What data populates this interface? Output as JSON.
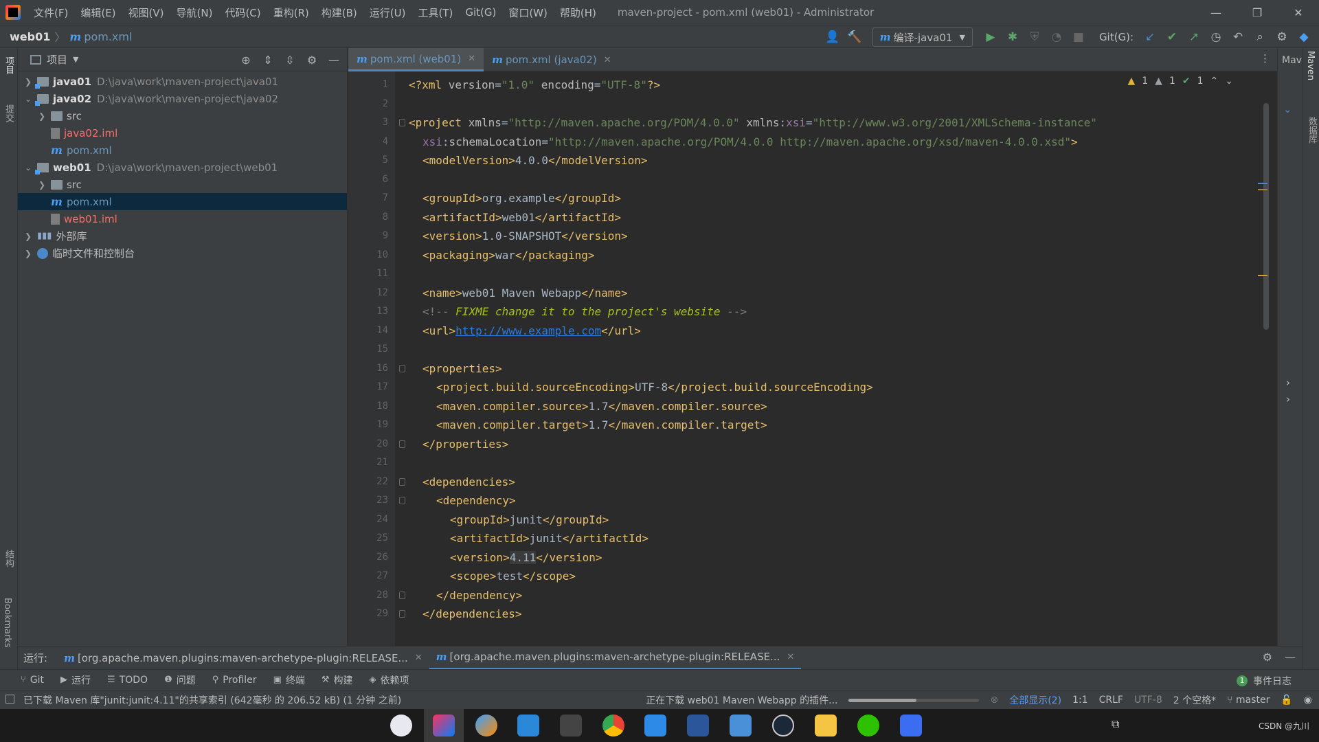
{
  "menubar": {
    "items": [
      "文件(F)",
      "编辑(E)",
      "视图(V)",
      "导航(N)",
      "代码(C)",
      "重构(R)",
      "构建(B)",
      "运行(U)",
      "工具(T)",
      "Git(G)",
      "窗口(W)",
      "帮助(H)"
    ],
    "title": "maven-project - pom.xml (web01) - Administrator"
  },
  "navbar": {
    "crumb_module": "web01",
    "crumb_file": "pom.xml",
    "run_config": "编译-java01",
    "git_label": "Git(G):"
  },
  "left_stripe": {
    "project": "项目",
    "commit": "提交",
    "structure": "结构",
    "bookmarks": "Bookmarks"
  },
  "project": {
    "title": "项目",
    "tree": [
      {
        "name": "java01",
        "path": "D:\\java\\work\\maven-project\\java01"
      },
      {
        "name": "java02",
        "path": "D:\\java\\work\\maven-project\\java02"
      },
      {
        "name": "src"
      },
      {
        "name": "java02.iml"
      },
      {
        "name": "pom.xml"
      },
      {
        "name": "web01",
        "path": "D:\\java\\work\\maven-project\\web01"
      },
      {
        "name": "src"
      },
      {
        "name": "pom.xml"
      },
      {
        "name": "web01.iml"
      },
      {
        "name": "外部库"
      },
      {
        "name": "临时文件和控制台"
      }
    ]
  },
  "editor": {
    "tabs": [
      {
        "label": "pom.xml (web01)"
      },
      {
        "label": "pom.xml (java02)"
      }
    ],
    "inspection": {
      "warn1": "1",
      "warn2": "1",
      "ok": "1"
    },
    "line_numbers": [
      "1",
      "2",
      "3",
      "4",
      "5",
      "6",
      "7",
      "8",
      "9",
      "10",
      "11",
      "12",
      "13",
      "14",
      "15",
      "16",
      "17",
      "18",
      "19",
      "20",
      "21",
      "22",
      "23",
      "24",
      "25",
      "26",
      "27",
      "28",
      "29"
    ],
    "code": {
      "l1": {
        "open": "<?xml ",
        "a1": "version",
        "eq1": "=",
        "v1": "\"1.0\"",
        "sp": " ",
        "a2": "encoding",
        "eq2": "=",
        "v2": "\"UTF-8\"",
        "close": "?>"
      },
      "l3": {
        "open": "<project ",
        "a1": "xmlns",
        "eq1": "=",
        "v1": "\"http://maven.apache.org/POM/4.0.0\"",
        "sp": " ",
        "a2": "xmlns",
        "colon": ":",
        "ns": "xsi",
        "eq2": "=",
        "v2": "\"http://www.w3.org/2001/XMLSchema-instance\""
      },
      "l4": {
        "ns": "xsi",
        "colon": ":",
        "a": "schemaLocation",
        "eq": "=",
        "v": "\"http://maven.apache.org/POM/4.0.0 http://maven.apache.org/xsd/maven-4.0.0.xsd\"",
        "close": ">"
      },
      "l5": {
        "o": "<modelVersion>",
        "t": "4.0.0",
        "c": "</modelVersion>"
      },
      "l7": {
        "o": "<groupId>",
        "t": "org.example",
        "c": "</groupId>"
      },
      "l8": {
        "o": "<artifactId>",
        "t": "web01",
        "c": "</artifactId>"
      },
      "l9": {
        "o": "<version>",
        "t": "1.0-SNAPSHOT",
        "c": "</version>"
      },
      "l10": {
        "o": "<packaging>",
        "t": "war",
        "c": "</packaging>"
      },
      "l12": {
        "o": "<name>",
        "t": "web01 Maven Webapp",
        "c": "</name>"
      },
      "l13": {
        "o": "<!-- ",
        "fixme": "FIXME change it to the project's website",
        "c": " -->"
      },
      "l14": {
        "o": "<url>",
        "t": "http://www.example.com",
        "c": "</url>"
      },
      "l16": {
        "o": "<properties>"
      },
      "l17": {
        "o": "<project.build.sourceEncoding>",
        "t": "UTF-8",
        "c": "</project.build.sourceEncoding>"
      },
      "l18": {
        "o": "<maven.compiler.source>",
        "t": "1.7",
        "c": "</maven.compiler.source>"
      },
      "l19": {
        "o": "<maven.compiler.target>",
        "t": "1.7",
        "c": "</maven.compiler.target>"
      },
      "l20": {
        "c": "</properties>"
      },
      "l22": {
        "o": "<dependencies>"
      },
      "l23": {
        "o": "<dependency>"
      },
      "l24": {
        "o": "<groupId>",
        "t": "junit",
        "c": "</groupId>"
      },
      "l25": {
        "o": "<artifactId>",
        "t": "junit",
        "c": "</artifactId>"
      },
      "l26": {
        "o": "<version>",
        "t": "4.11",
        "c": "</version>"
      },
      "l27": {
        "o": "<scope>",
        "t": "test",
        "c": "</scope>"
      },
      "l28": {
        "c": "</dependency>"
      },
      "l29": {
        "c": "</dependencies>"
      }
    }
  },
  "maven_panel": {
    "title": "Mav",
    "stripe_label": "Maven",
    "db_label": "数据库"
  },
  "run_panel": {
    "label": "运行:",
    "tabs": [
      {
        "label": "[org.apache.maven.plugins:maven-archetype-plugin:RELEASE..."
      },
      {
        "label": "[org.apache.maven.plugins:maven-archetype-plugin:RELEASE..."
      }
    ]
  },
  "toolwindows": {
    "git": "Git",
    "run": "运行",
    "todo": "TODO",
    "problems": "问题",
    "profiler": "Profiler",
    "terminal": "终端",
    "build": "构建",
    "dependencies": "依赖项",
    "event_log": "事件日志",
    "event_count": "1"
  },
  "statusbar": {
    "left": "已下载 Maven 库\"junit:junit:4.11\"的共享索引 (642毫秒 的 206.52 kB) (1 分钟 之前)",
    "progress_text": "正在下载 web01 Maven Webapp 的插件...",
    "progress": 0.52,
    "show_all": "全部显示(2)",
    "position": "1:1",
    "line_sep": "CRLF",
    "encoding": "UTF-8",
    "indent": "2 个空格*",
    "branch": "master"
  },
  "taskbar": {
    "csdn": "CSDN @九川"
  }
}
